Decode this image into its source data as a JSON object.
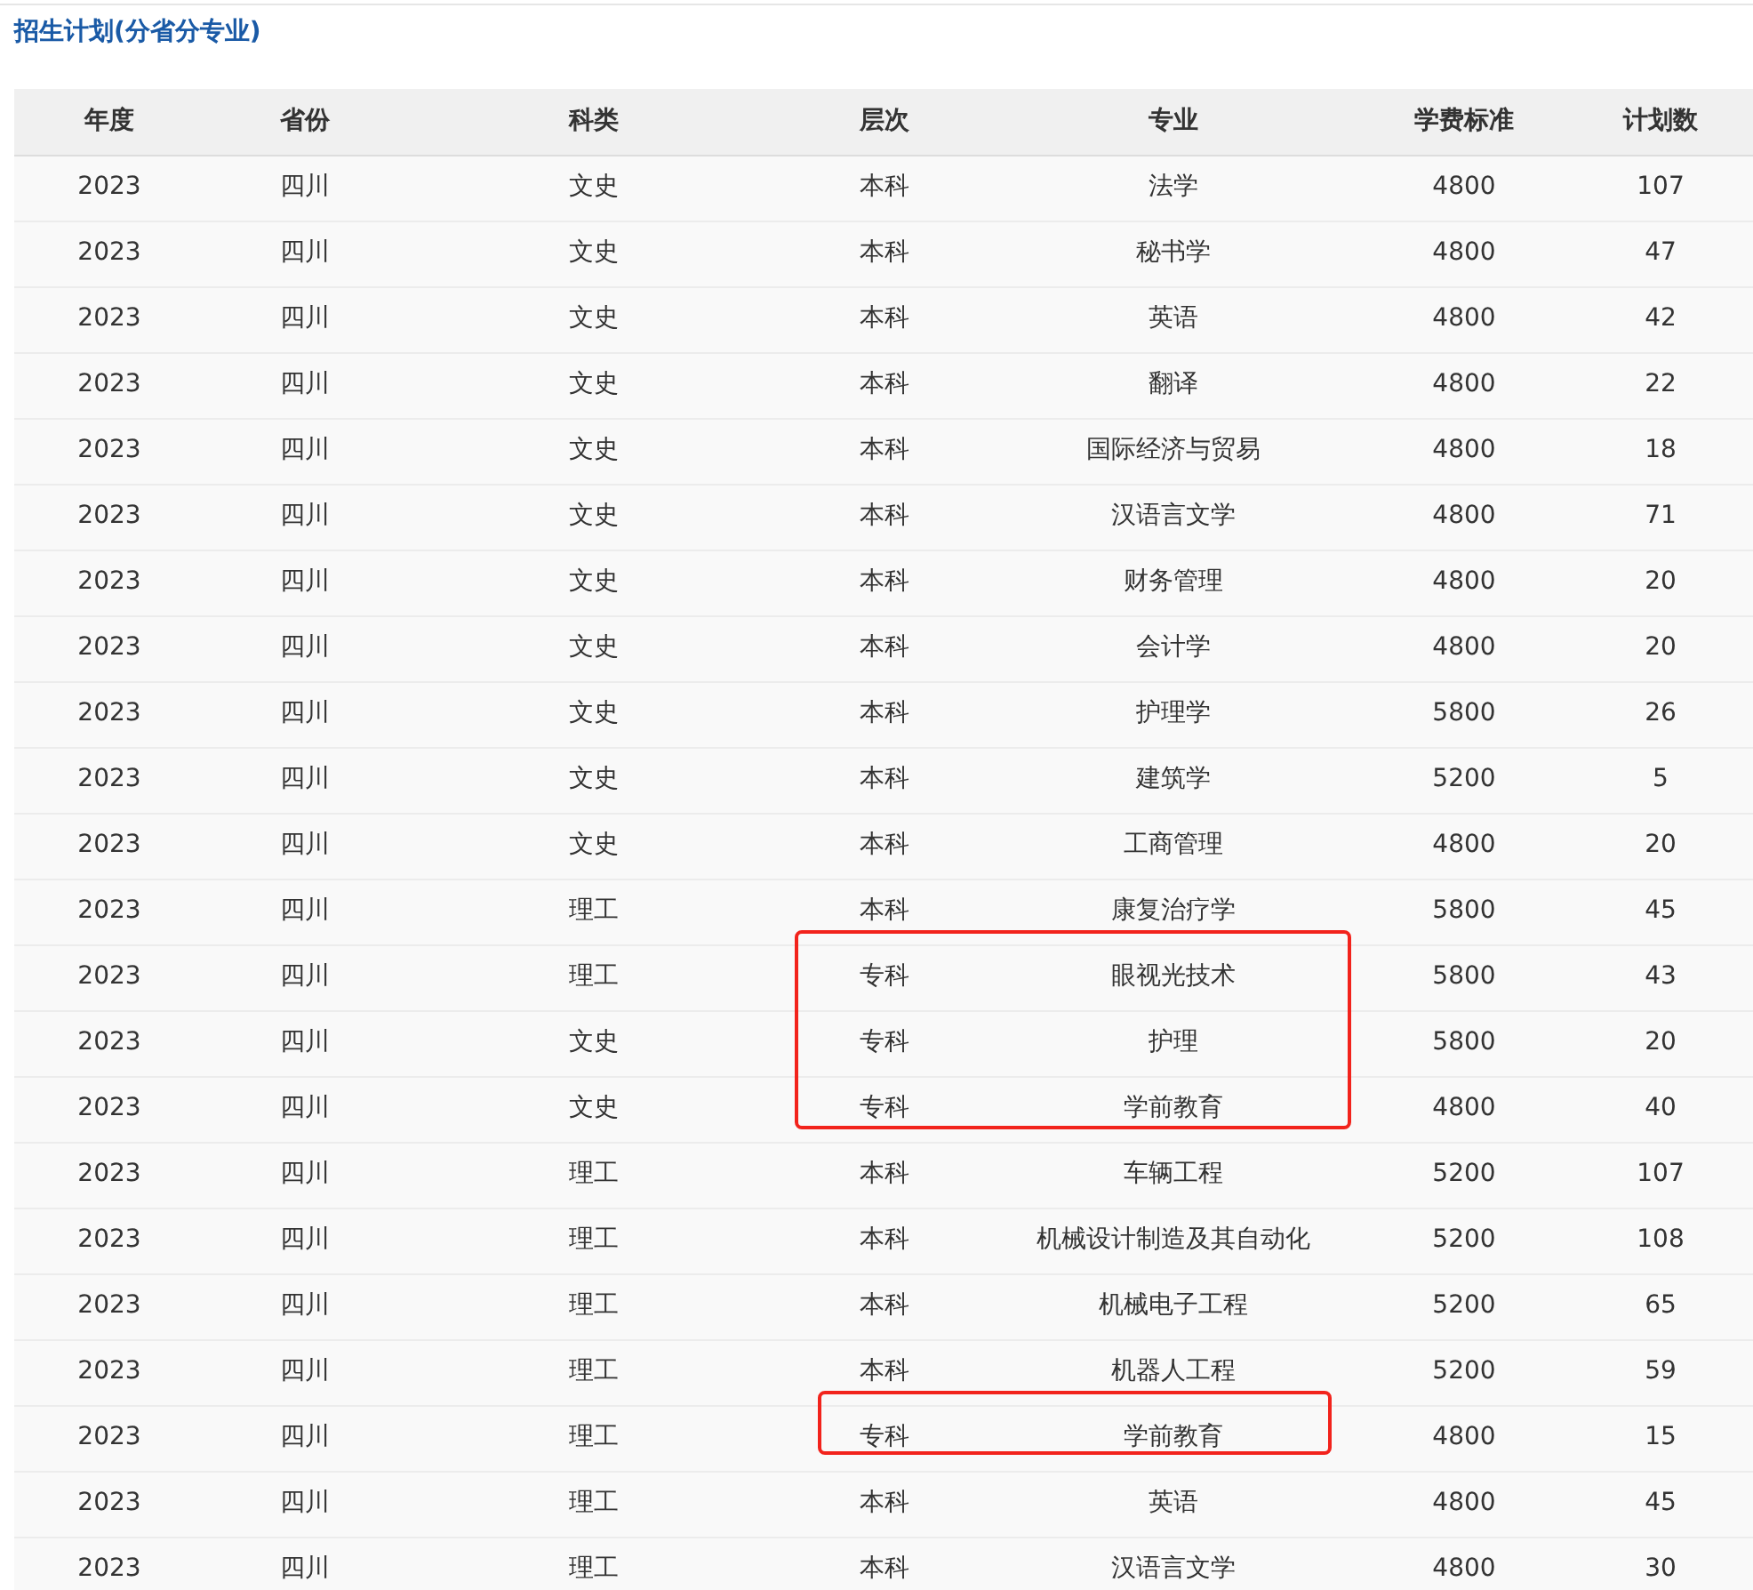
{
  "title": "招生计划(分省分专业)",
  "table": {
    "columns": [
      "年度",
      "省份",
      "科类",
      "层次",
      "专业",
      "学费标准",
      "计划数"
    ],
    "rows": [
      {
        "cells": [
          "2023",
          "四川",
          "文史",
          "本科",
          "法学",
          "4800",
          "107"
        ],
        "marked": false
      },
      {
        "cells": [
          "2023",
          "四川",
          "文史",
          "本科",
          "秘书学",
          "4800",
          "47"
        ],
        "marked": false
      },
      {
        "cells": [
          "2023",
          "四川",
          "文史",
          "本科",
          "英语",
          "4800",
          "42"
        ],
        "marked": false
      },
      {
        "cells": [
          "2023",
          "四川",
          "文史",
          "本科",
          "翻译",
          "4800",
          "22"
        ],
        "marked": false
      },
      {
        "cells": [
          "2023",
          "四川",
          "文史",
          "本科",
          "国际经济与贸易",
          "4800",
          "18"
        ],
        "marked": false
      },
      {
        "cells": [
          "2023",
          "四川",
          "文史",
          "本科",
          "汉语言文学",
          "4800",
          "71"
        ],
        "marked": false
      },
      {
        "cells": [
          "2023",
          "四川",
          "文史",
          "本科",
          "财务管理",
          "4800",
          "20"
        ],
        "marked": false
      },
      {
        "cells": [
          "2023",
          "四川",
          "文史",
          "本科",
          "会计学",
          "4800",
          "20"
        ],
        "marked": false
      },
      {
        "cells": [
          "2023",
          "四川",
          "文史",
          "本科",
          "护理学",
          "5800",
          "26"
        ],
        "marked": false
      },
      {
        "cells": [
          "2023",
          "四川",
          "文史",
          "本科",
          "建筑学",
          "5200",
          "5"
        ],
        "marked": false
      },
      {
        "cells": [
          "2023",
          "四川",
          "文史",
          "本科",
          "工商管理",
          "4800",
          "20"
        ],
        "marked": false
      },
      {
        "cells": [
          "2023",
          "四川",
          "理工",
          "本科",
          "康复治疗学",
          "5800",
          "45"
        ],
        "marked": false
      },
      {
        "cells": [
          "2023",
          "四川",
          "理工",
          "专科",
          "眼视光技术",
          "5800",
          "43"
        ],
        "marked": true
      },
      {
        "cells": [
          "2023",
          "四川",
          "文史",
          "专科",
          "护理",
          "5800",
          "20"
        ],
        "marked": true
      },
      {
        "cells": [
          "2023",
          "四川",
          "文史",
          "专科",
          "学前教育",
          "4800",
          "40"
        ],
        "marked": true
      },
      {
        "cells": [
          "2023",
          "四川",
          "理工",
          "本科",
          "车辆工程",
          "5200",
          "107"
        ],
        "marked": false
      },
      {
        "cells": [
          "2023",
          "四川",
          "理工",
          "本科",
          "机械设计制造及其自动化",
          "5200",
          "108"
        ],
        "marked": false
      },
      {
        "cells": [
          "2023",
          "四川",
          "理工",
          "本科",
          "机械电子工程",
          "5200",
          "65"
        ],
        "marked": false
      },
      {
        "cells": [
          "2023",
          "四川",
          "理工",
          "本科",
          "机器人工程",
          "5200",
          "59"
        ],
        "marked": false
      },
      {
        "cells": [
          "2023",
          "四川",
          "理工",
          "专科",
          "学前教育",
          "4800",
          "15"
        ],
        "marked": true
      },
      {
        "cells": [
          "2023",
          "四川",
          "理工",
          "本科",
          "英语",
          "4800",
          "45"
        ],
        "marked": false
      },
      {
        "cells": [
          "2023",
          "四川",
          "理工",
          "本科",
          "汉语言文学",
          "4800",
          "30"
        ],
        "marked": false
      }
    ]
  }
}
